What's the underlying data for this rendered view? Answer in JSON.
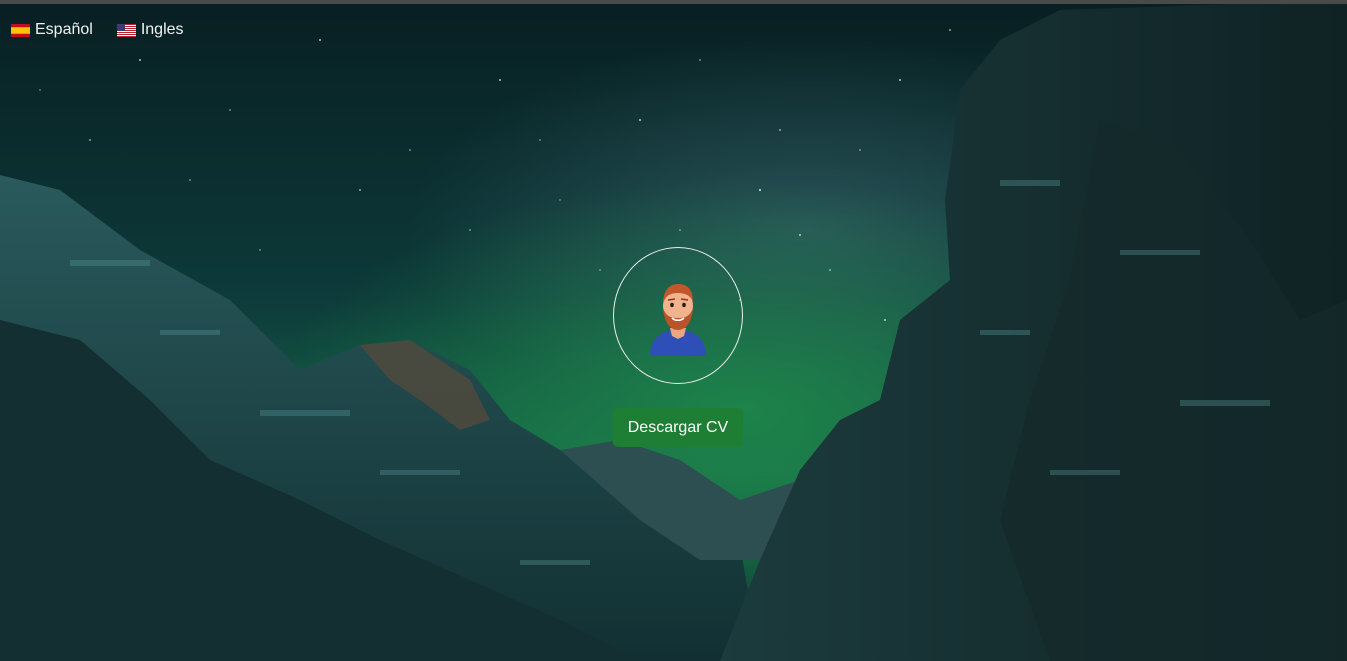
{
  "nav": {
    "languages": [
      {
        "flag_icon": "spain-flag-icon",
        "label": "Español"
      },
      {
        "flag_icon": "usa-flag-icon",
        "label": "Ingles"
      }
    ]
  },
  "hero": {
    "avatar_icon": "bearded-man-avatar-icon",
    "cta_label": "Descargar CV"
  },
  "theme": {
    "button_color": "#1e7e34",
    "sky_color": "#0d3a3a",
    "glow_color": "#1f8a4a",
    "rock_color": "#1c3b3d"
  }
}
